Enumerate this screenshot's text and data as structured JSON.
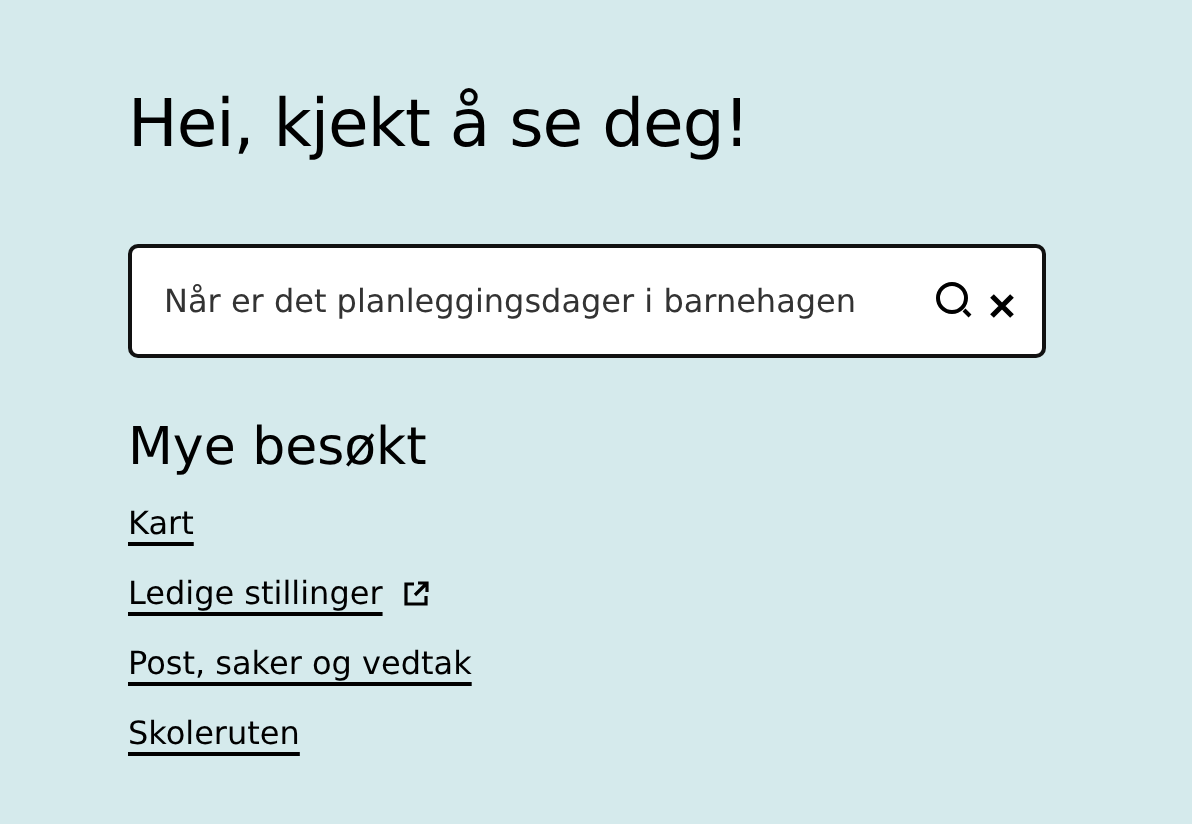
{
  "greeting": "Hei, kjekt å se deg!",
  "search": {
    "value": "Når er det planleggingsdager i barnehagen"
  },
  "popular": {
    "title": "Mye besøkt",
    "links": [
      {
        "label": "Kart",
        "external": false
      },
      {
        "label": "Ledige stillinger",
        "external": true
      },
      {
        "label": "Post, saker og vedtak",
        "external": false
      },
      {
        "label": "Skoleruten",
        "external": false
      }
    ]
  }
}
